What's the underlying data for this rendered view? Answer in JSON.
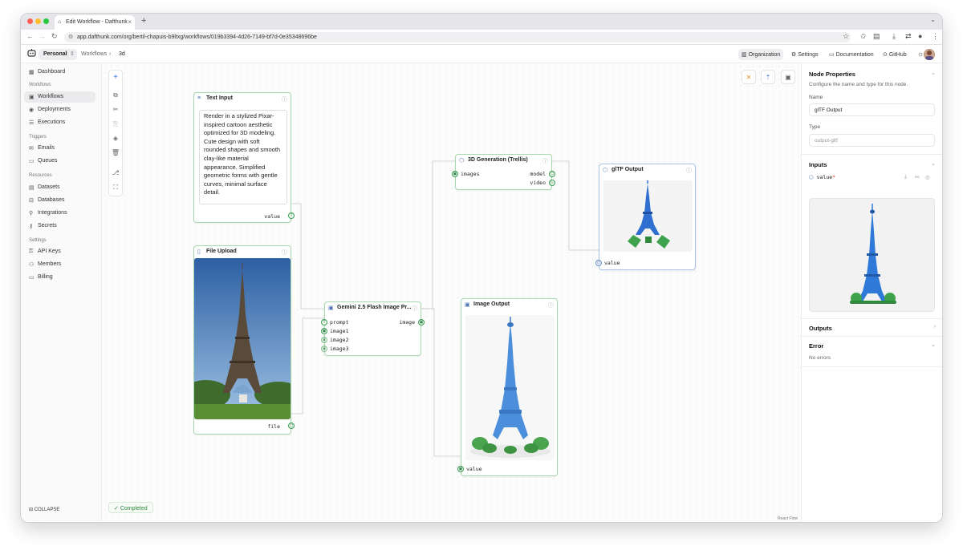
{
  "browser": {
    "tab_title": "Edit Workflow - Dafthunk",
    "url": "app.dafthunk.com/org/bertil-chapuis-b9ltxg/workflows/019b3394-4d26-7149-bf7d-0e35348696be"
  },
  "header": {
    "workspace": "Personal",
    "breadcrumb": [
      "Workflows",
      "3d"
    ],
    "buttons": [
      "Organization",
      "Settings",
      "Documentation",
      "GitHub"
    ]
  },
  "sidebar": {
    "top": {
      "label": "Dashboard",
      "icon": "dashboard-icon"
    },
    "sections": [
      {
        "title": "Workflows",
        "items": [
          {
            "label": "Workflows",
            "icon": "workflows-icon",
            "active": true
          },
          {
            "label": "Deployments",
            "icon": "deployments-icon"
          },
          {
            "label": "Executions",
            "icon": "executions-icon"
          }
        ]
      },
      {
        "title": "Triggers",
        "items": [
          {
            "label": "Emails",
            "icon": "mail-icon"
          },
          {
            "label": "Queues",
            "icon": "queue-icon"
          }
        ]
      },
      {
        "title": "Resources",
        "items": [
          {
            "label": "Datasets",
            "icon": "dataset-icon"
          },
          {
            "label": "Databases",
            "icon": "database-icon"
          },
          {
            "label": "Integrations",
            "icon": "integrations-icon"
          },
          {
            "label": "Secrets",
            "icon": "key-icon"
          }
        ]
      },
      {
        "title": "Settings",
        "items": [
          {
            "label": "API Keys",
            "icon": "api-key-icon"
          },
          {
            "label": "Members",
            "icon": "members-icon"
          },
          {
            "label": "Billing",
            "icon": "billing-icon"
          }
        ]
      }
    ],
    "collapse": "COLLAPSE"
  },
  "canvas": {
    "status": "Completed",
    "attribution": "React Flow"
  },
  "nodes": {
    "text_input": {
      "title": "Text Input",
      "text": "Render in a stylized Pixar-inspired cartoon aesthetic optimized for 3D modeling. Cute design with soft rounded shapes and smooth clay-like material appearance. Simplified geometric forms with gentle curves, minimal surface detail.",
      "output": "value",
      "output_badge": "T"
    },
    "file_upload": {
      "title": "File Upload",
      "output": "file"
    },
    "gemini": {
      "title": "Gemini 2.5 Flash Image Pr...",
      "inputs": [
        "prompt",
        "image1",
        "image2",
        "image3"
      ],
      "output": "image"
    },
    "trellis": {
      "title": "3D Generation (Trellis)",
      "inputs": [
        "images"
      ],
      "outputs": [
        "model",
        "video"
      ]
    },
    "gltf_output": {
      "title": "glTF Output",
      "input": "value"
    },
    "image_output": {
      "title": "Image Output",
      "input": "value"
    }
  },
  "panel": {
    "title": "Node Properties",
    "subtitle": "Configure the name and type for this node.",
    "name_label": "Name",
    "name_value": "glTF Output",
    "type_label": "Type",
    "type_value": "output-gltf",
    "inputs_title": "Inputs",
    "input_name": "value",
    "input_required": "*",
    "outputs_title": "Outputs",
    "error_title": "Error",
    "error_text": "No errors"
  },
  "colors": {
    "port_green": "#3a9d52",
    "node_border": "#a8d8ae",
    "selected_border": "#a9c2e4",
    "model_blue": "#3b7fd8",
    "model_green": "#3fa34d"
  }
}
